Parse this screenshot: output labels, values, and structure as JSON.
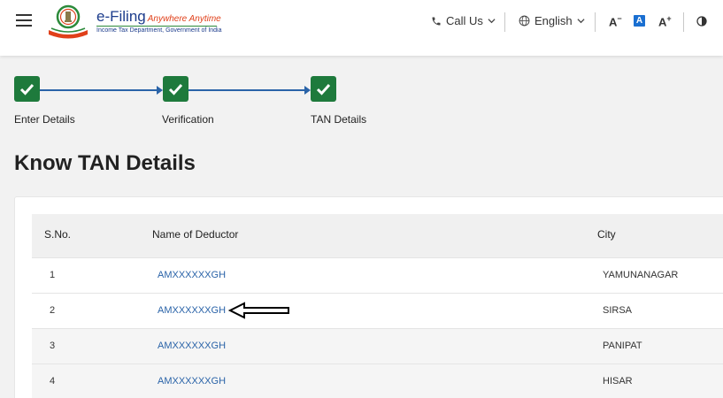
{
  "header": {
    "brand_title": "e-Filing",
    "brand_tagline": "Anywhere Anytime",
    "brand_subtitle": "Income Tax Department, Government of India",
    "emblem_caption": "INCOME TAX DEPARTMENT",
    "call_us": "Call Us",
    "language": "English",
    "font_decrease": "A",
    "font_default": "A",
    "font_increase": "A"
  },
  "stepper": {
    "steps": [
      {
        "label": "Enter Details"
      },
      {
        "label": "Verification"
      },
      {
        "label": "TAN Details"
      }
    ]
  },
  "page": {
    "title": "Know TAN Details"
  },
  "table": {
    "headers": {
      "sno": "S.No.",
      "name": "Name of Deductor",
      "city": "City"
    },
    "rows": [
      {
        "sno": "1",
        "name": "AMXXXXXXGH",
        "city": "YAMUNANAGAR"
      },
      {
        "sno": "2",
        "name": "AMXXXXXXGH",
        "city": "SIRSA"
      },
      {
        "sno": "3",
        "name": "AMXXXXXXGH",
        "city": "PANIPAT"
      },
      {
        "sno": "4",
        "name": "AMXXXXXXGH",
        "city": "HISAR"
      }
    ]
  },
  "colors": {
    "primary": "#2a63a8",
    "success": "#1e7a3c",
    "brand_accent": "#e0401a"
  }
}
